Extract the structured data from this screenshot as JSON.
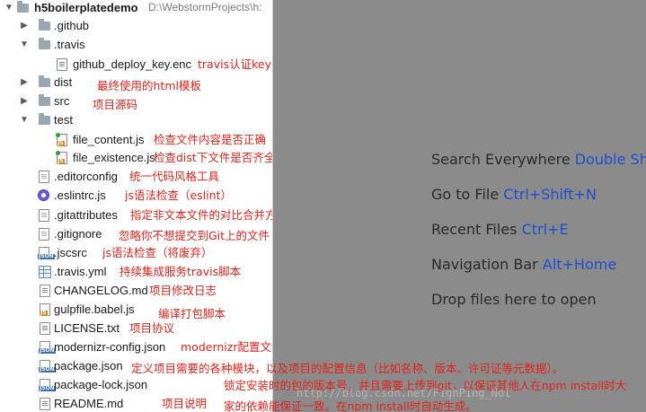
{
  "project": {
    "name": "h5boilerplatedemo",
    "path": "D:\\WebstormProjects\\h:"
  },
  "tree": [
    {
      "label": ".github",
      "note": "",
      "icon": "folder-icon"
    },
    {
      "label": ".travis",
      "note": "",
      "icon": "folder-icon"
    },
    {
      "label": "github_deploy_key.enc",
      "note": "travis认证key",
      "icon": "file-icon"
    },
    {
      "label": "dist",
      "note": "最终使用的html模板",
      "icon": "folder-icon"
    },
    {
      "label": "src",
      "note": "项目源码",
      "icon": "folder-icon"
    },
    {
      "label": "test",
      "note": "",
      "icon": "folder-icon"
    },
    {
      "label": "file_content.js",
      "note": "检查文件内容是否正确",
      "icon": "js-test-file-icon"
    },
    {
      "label": "file_existence.js",
      "note": "检查dist下文件是否齐全",
      "icon": "js-test-file-icon"
    },
    {
      "label": ".editorconfig",
      "note": "统一代码风格工具",
      "icon": "config-file-icon"
    },
    {
      "label": ".eslintrc.js",
      "note": "js语法检查（eslint）",
      "icon": "eslint-icon"
    },
    {
      "label": ".gitattributes",
      "note": "指定非文本文件的对比合并方式",
      "icon": "git-file-icon"
    },
    {
      "label": ".gitignore",
      "note": "忽略你不想提交到Git上的文件",
      "icon": "git-file-icon"
    },
    {
      "label": ".jscsrc",
      "note": "js语法检查（将废弃）",
      "icon": "json-file-icon"
    },
    {
      "label": ".travis.yml",
      "note": "持续集成服务travis脚本",
      "icon": "yaml-file-icon"
    },
    {
      "label": "CHANGELOG.md",
      "note": "项目修改日志",
      "icon": "markdown-file-icon"
    },
    {
      "label": "gulpfile.babel.js",
      "note": "编译打包脚本",
      "icon": "js-file-icon"
    },
    {
      "label": "LICENSE.txt",
      "note": "项目协议",
      "icon": "text-file-icon"
    },
    {
      "label": "modernizr-config.json",
      "note": "modernizr配置文件",
      "icon": "json-file-icon"
    },
    {
      "label": "package.json",
      "note": "定义项目需要的各种模块，以及项目的配置信息（比如名称、版本、许可证等元数据）。",
      "icon": "json-file-icon"
    },
    {
      "label": "package-lock.json",
      "note": "锁定安装时的包的版本号，并且需要上传到git，以保证其他人在npm install时大",
      "icon": "json-file-icon"
    },
    {
      "label": "README.md",
      "note": "项目说明",
      "icon": "markdown-file-icon"
    }
  ],
  "extra_note": "家的依赖能保证一致。在npm install时自动生成。",
  "editor_hints": [
    {
      "action": "Search Everywhere",
      "shortcut": "Double Shift"
    },
    {
      "action": "Go to File",
      "shortcut": "Ctrl+Shift+N"
    },
    {
      "action": "Recent Files",
      "shortcut": "Ctrl+E"
    },
    {
      "action": "Navigation Bar",
      "shortcut": "Alt+Home"
    },
    {
      "action": "Drop files here to open",
      "shortcut": ""
    }
  ],
  "watermark": "http://blog.csdn.net/FighPing_Nol"
}
